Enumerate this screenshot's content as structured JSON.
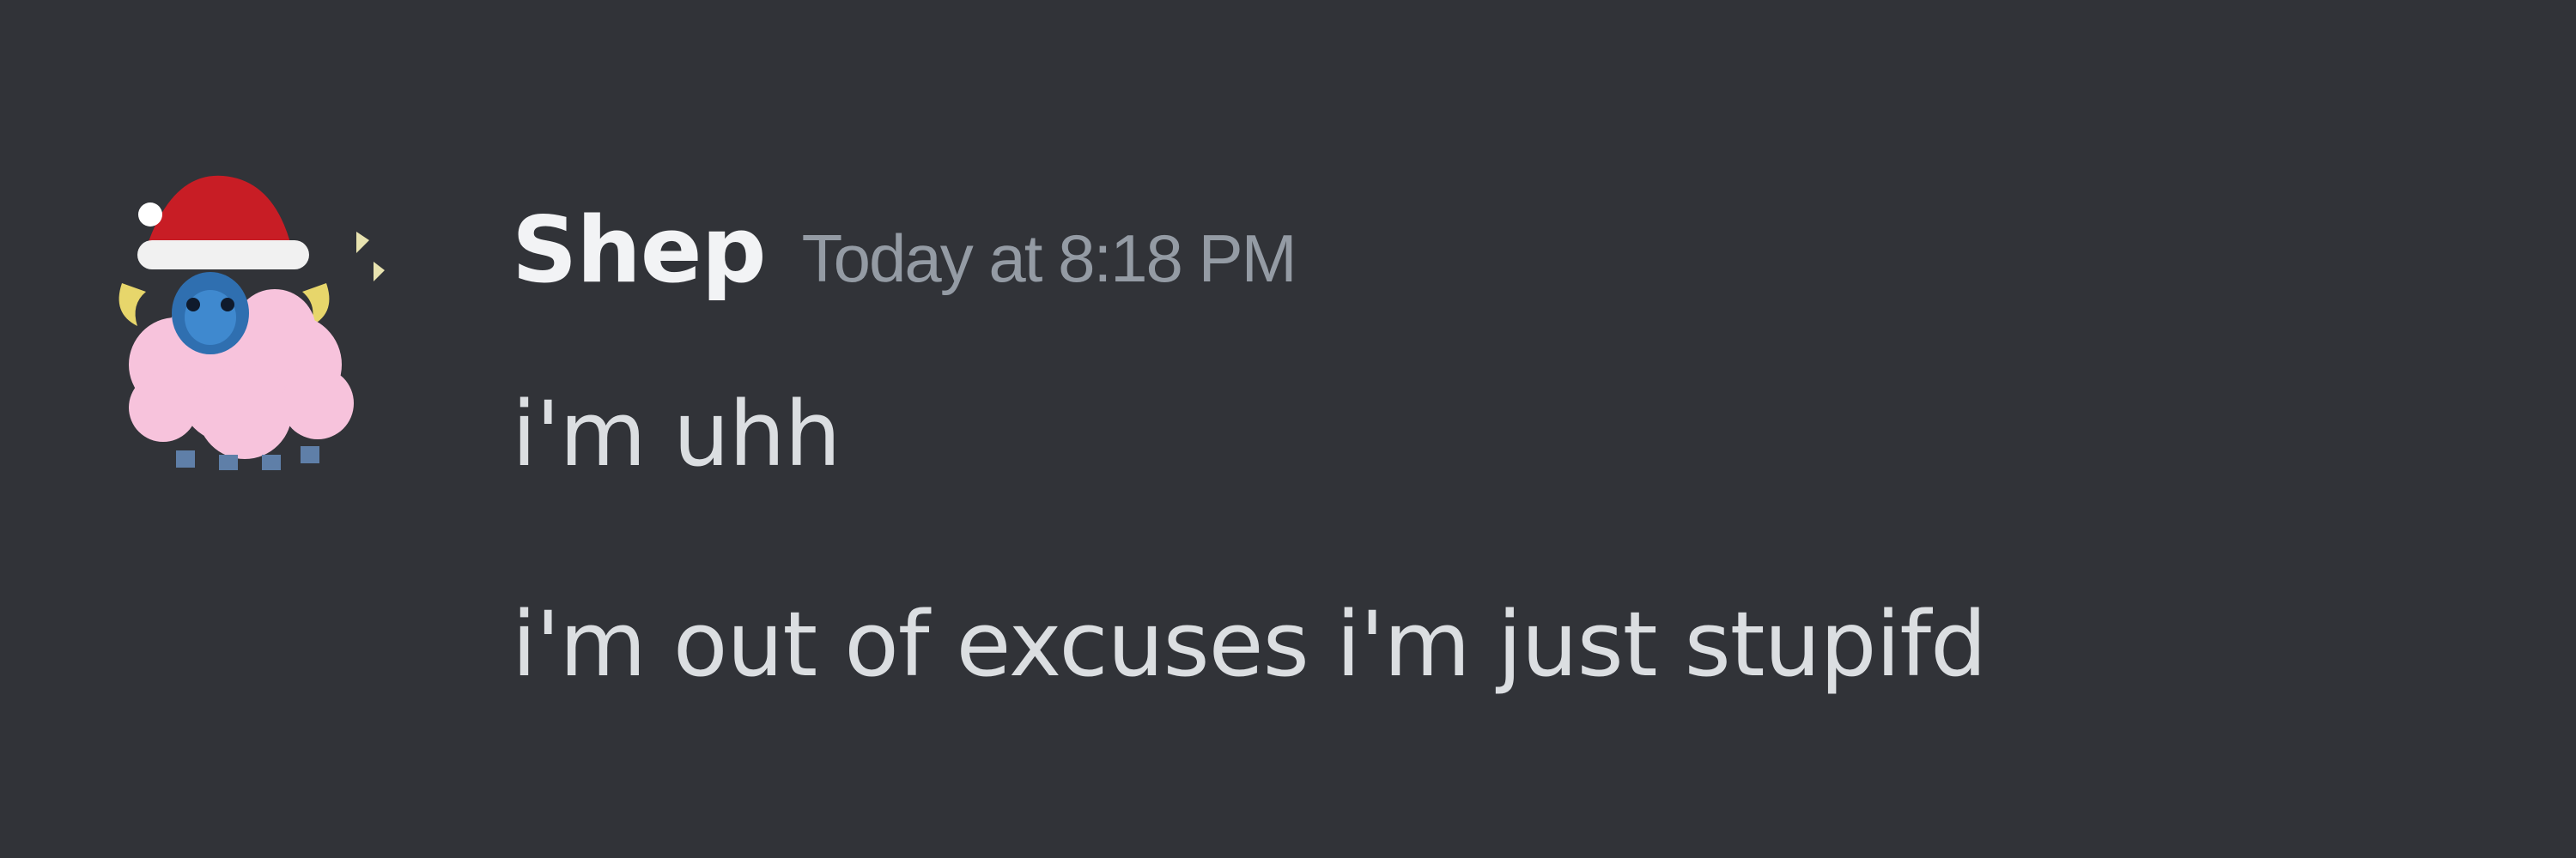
{
  "message": {
    "author": {
      "username": "Shep",
      "avatar_icon": "pink-sheep-santa-hat-avatar"
    },
    "timestamp": "Today at 8:18 PM",
    "lines": [
      "i'm uhh",
      "i'm out of excuses i'm just stupifd"
    ]
  },
  "colors": {
    "background": "#313338",
    "username": "#f2f3f5",
    "timestamp": "#949ba4",
    "message_text": "#dbdee1"
  }
}
